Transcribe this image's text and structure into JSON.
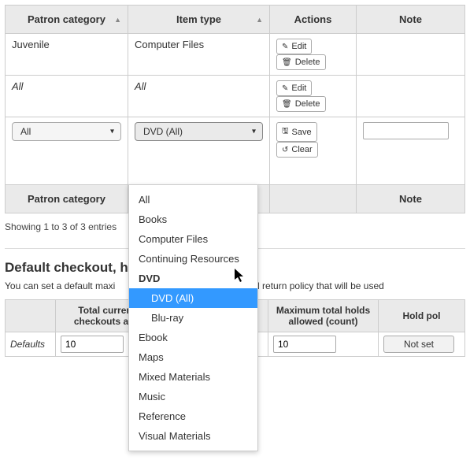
{
  "columns": {
    "patron_category": "Patron category",
    "item_type": "Item type",
    "actions": "Actions",
    "note": "Note"
  },
  "rows": [
    {
      "patron": "Juvenile",
      "item": "Computer Files",
      "italic": false
    },
    {
      "patron": "All",
      "item": "All",
      "italic": true
    }
  ],
  "buttons": {
    "edit": "Edit",
    "delete": "Delete",
    "save": "Save",
    "clear": "Clear"
  },
  "input_row": {
    "patron_value": "All",
    "item_value": "DVD (All)"
  },
  "dropdown": {
    "options": [
      {
        "label": "All",
        "kind": "plain"
      },
      {
        "label": "Books",
        "kind": "plain"
      },
      {
        "label": "Computer Files",
        "kind": "plain"
      },
      {
        "label": "Continuing Resources",
        "kind": "plain"
      },
      {
        "label": "DVD",
        "kind": "group"
      },
      {
        "label": "DVD (All)",
        "kind": "child",
        "selected": true
      },
      {
        "label": "Blu-ray",
        "kind": "child"
      },
      {
        "label": "Ebook",
        "kind": "plain"
      },
      {
        "label": "Maps",
        "kind": "plain"
      },
      {
        "label": "Mixed Materials",
        "kind": "plain"
      },
      {
        "label": "Music",
        "kind": "plain"
      },
      {
        "label": "Reference",
        "kind": "plain"
      },
      {
        "label": "Visual Materials",
        "kind": "plain"
      }
    ]
  },
  "status": "Showing 1 to 3 of 3 entries",
  "section": {
    "heading_visible": "Default checkout, h",
    "desc_pre": "You can set a default maxi",
    "desc_post": "old policy and return policy that will be used",
    "cols": {
      "blank": "",
      "total_checkouts": "Total current checkouts allo",
      "max_holds": "Maximum total holds allowed (count)",
      "hold_pol": "Hold pol"
    },
    "row_label": "Defaults",
    "val1": "10",
    "val2": "",
    "val3": "10",
    "not_set": "Not set"
  }
}
